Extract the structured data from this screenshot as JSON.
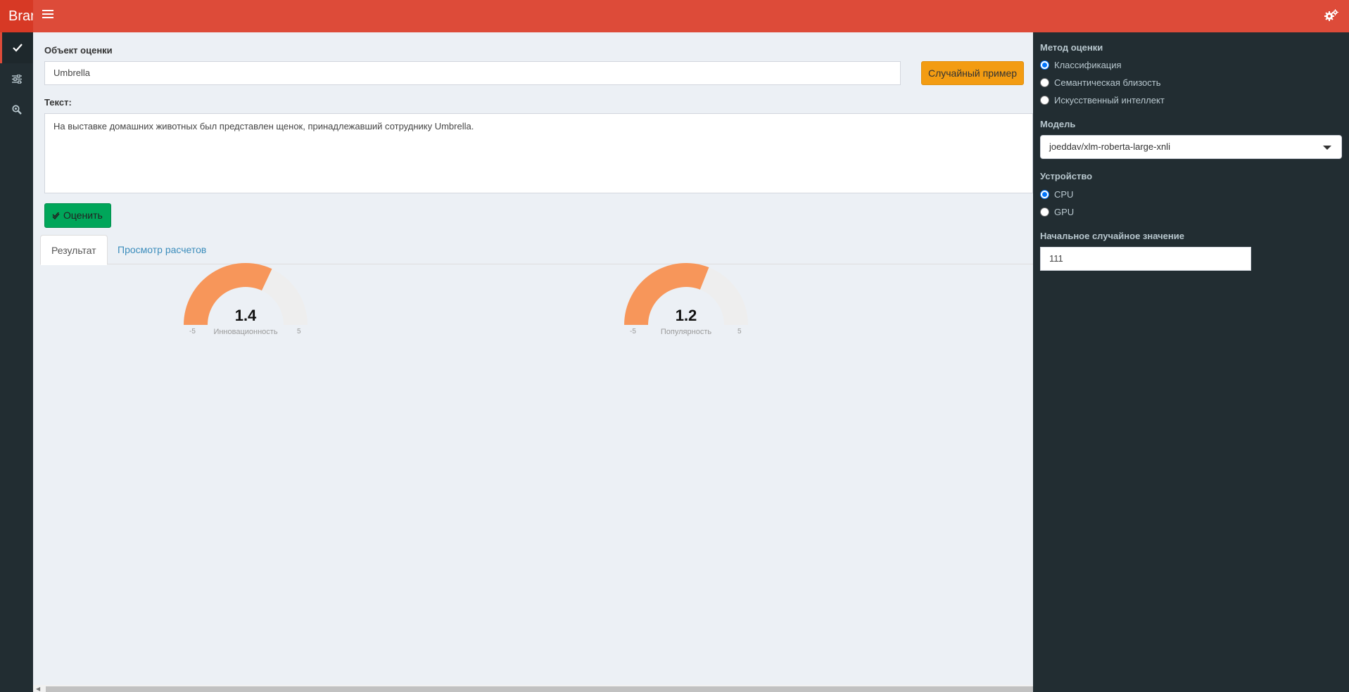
{
  "header": {
    "brand": "Brar"
  },
  "main": {
    "object_label": "Объект оценки",
    "object_value": "Umbrella",
    "random_button": "Случайный пример",
    "text_label": "Текст:",
    "text_value": "На выставке домашних животных был представлен щенок, принадлежавший сотруднику Umbrella.",
    "eval_button": "Оценить",
    "tabs": [
      {
        "label": "Результат",
        "active": true
      },
      {
        "label": "Просмотр расчетов",
        "active": false
      }
    ],
    "gauges": [
      {
        "value": "1.4",
        "label": "Инновационность",
        "min": "-5",
        "max": "5",
        "fraction": 0.64
      },
      {
        "value": "1.2",
        "label": "Популярность",
        "min": "-5",
        "max": "5",
        "fraction": 0.62
      }
    ]
  },
  "sidebar": {
    "method_title": "Метод оценки",
    "methods": [
      {
        "label": "Классификация",
        "checked": true
      },
      {
        "label": "Семантическая близость",
        "checked": false
      },
      {
        "label": "Искусственный интеллект",
        "checked": false
      }
    ],
    "model_title": "Модель",
    "model_value": "joeddav/xlm-roberta-large-xnli",
    "device_title": "Устройство",
    "devices": [
      {
        "label": "CPU",
        "checked": true
      },
      {
        "label": "GPU",
        "checked": false
      }
    ],
    "seed_title": "Начальное случайное значение",
    "seed_value": "111"
  },
  "colors": {
    "header": "#dd4b39",
    "sidebar": "#222d32",
    "gauge_fill": "#f7965a",
    "gauge_track": "#eeeeee",
    "btn_warning": "#f39c12",
    "btn_success": "#00a65a"
  }
}
